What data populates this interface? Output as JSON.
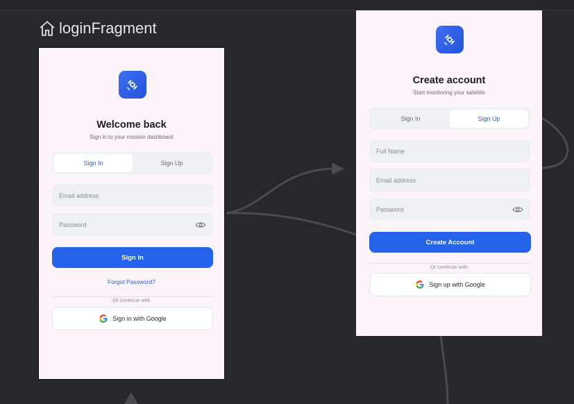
{
  "fragment": {
    "title": "loginFragment",
    "icon": "home-icon"
  },
  "login": {
    "title": "Welcome back",
    "subtitle": "Sign in to your mission dashboard",
    "tabs": [
      {
        "label": "Sign In",
        "active": true
      },
      {
        "label": "Sign Up",
        "active": false
      }
    ],
    "email_placeholder": "Email address",
    "password_placeholder": "Password",
    "submit_label": "Sign In",
    "forgot_label": "Forgot Password?",
    "divider_text": "Or continue with",
    "google_label": "Sign in with Google"
  },
  "signup": {
    "title": "Create account",
    "subtitle": "Start monitoring your satellite",
    "tabs": [
      {
        "label": "Sign In",
        "active": false
      },
      {
        "label": "Sign Up",
        "active": true
      }
    ],
    "name_placeholder": "Full Name",
    "email_placeholder": "Email address",
    "password_placeholder": "Password",
    "submit_label": "Create Account",
    "divider_text": "Or continue with",
    "google_label": "Sign up with Google"
  },
  "colors": {
    "canvas": "#27282c",
    "screen_bg": "#fdf3fa",
    "accent": "#2563eb",
    "field_bg": "#eef0f4"
  }
}
